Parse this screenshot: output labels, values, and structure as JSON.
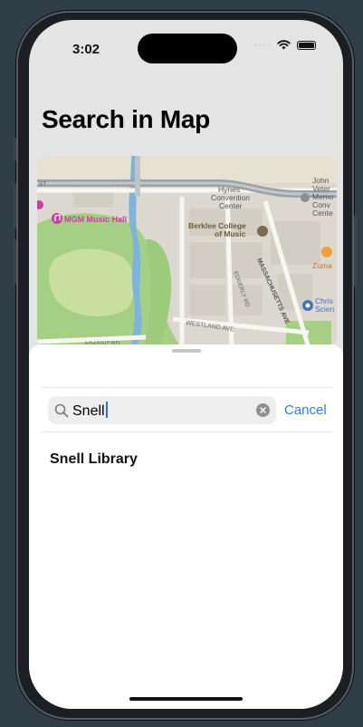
{
  "status": {
    "time": "3:02"
  },
  "page": {
    "title": "Search in Map"
  },
  "map": {
    "labels": {
      "venue": "MGM Music Hall",
      "convention_1": "Hynes",
      "convention_2": "Convention",
      "convention_3": "Center",
      "berklee_1": "Berklee College",
      "berklee_2": "of Music",
      "john_1": "John",
      "john_2": "Veter",
      "memorial_1": "Memo",
      "memorial_2": "Conv",
      "memorial_3": "Cente",
      "zuma": "Zuma",
      "christian_1": "Chris",
      "christian_2": "Scien",
      "massachusetts": "MASSACHUSETTS AVE",
      "westland": "WESTLAND AVE",
      "edgerly": "EDGERLY RD",
      "agassiz": "AGASSIZ RD",
      "st": "ST"
    }
  },
  "search": {
    "value": "Snell",
    "cancel_label": "Cancel"
  },
  "results": [
    {
      "title": "Snell Library"
    }
  ],
  "colors": {
    "accent": "#2f7ed6",
    "park": "#9ecb7e",
    "water": "#7fb3d9",
    "venue_pin": "#c93fa3"
  }
}
